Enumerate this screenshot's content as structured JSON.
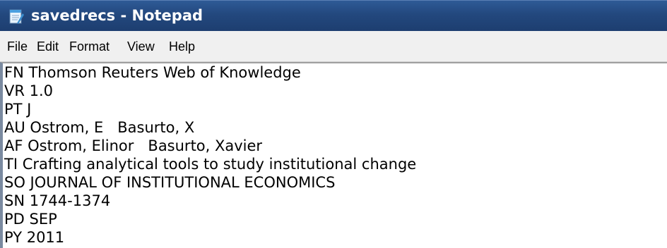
{
  "window": {
    "title": "savedrecs - Notepad",
    "app_icon": "notepad-icon"
  },
  "menu": {
    "items": [
      {
        "label": "File"
      },
      {
        "label": "Edit"
      },
      {
        "label": "Format"
      },
      {
        "label": "View"
      },
      {
        "label": "Help"
      }
    ]
  },
  "editor": {
    "lines": [
      "FN Thomson Reuters Web of Knowledge",
      "VR 1.0",
      "PT J",
      "AU Ostrom, E   Basurto, X",
      "AF Ostrom, Elinor   Basurto, Xavier",
      "TI Crafting analytical tools to study institutional change",
      "SO JOURNAL OF INSTITUTIONAL ECONOMICS",
      "SN 1744-1374",
      "PD SEP",
      "PY 2011"
    ]
  },
  "colors": {
    "titlebar": "#23487e",
    "menubar": "#f0f0f0",
    "editor_bg": "#ffffff"
  }
}
